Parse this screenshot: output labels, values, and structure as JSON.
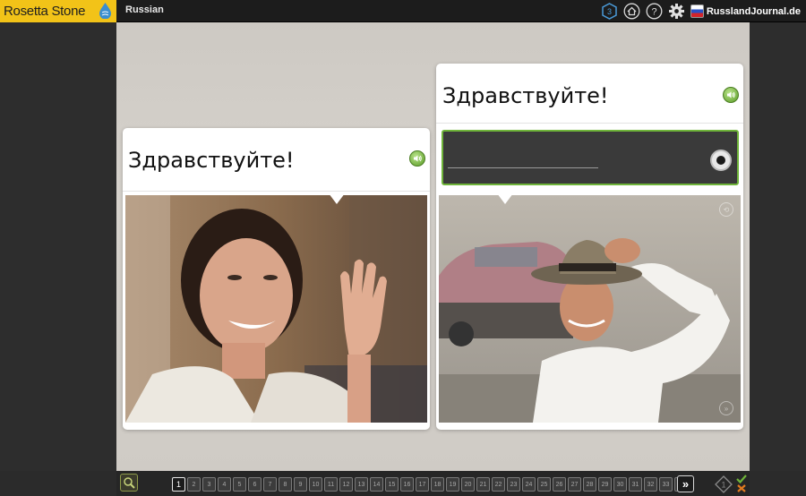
{
  "app": {
    "logo_text": "Rosetta Stone",
    "course": "Russian",
    "brand_text": "RusslandJournal.de",
    "top_icons": [
      "level-badge-icon",
      "home-icon",
      "help-icon",
      "gear-icon"
    ],
    "level_badge": "3"
  },
  "cards": [
    {
      "phrase": "Здравствуйте!",
      "speaker_icon": "speaker-icon",
      "photo": "woman waving"
    },
    {
      "phrase": "Здравствуйте!",
      "speaker_icon": "speaker-icon",
      "photo": "man with hat",
      "recorder": {
        "state": "idle",
        "record_icon": "record-button-icon"
      }
    }
  ],
  "bottom": {
    "pages": [
      "1",
      "2",
      "3",
      "4",
      "5",
      "6",
      "7",
      "8",
      "9",
      "10",
      "11",
      "12",
      "13",
      "14",
      "15",
      "16",
      "17",
      "18",
      "19",
      "20",
      "21",
      "22",
      "23",
      "24",
      "25",
      "26",
      "27",
      "28",
      "29",
      "30",
      "31",
      "32",
      "33",
      "34"
    ],
    "current_page": "1",
    "next_label": "»",
    "score_badge": "1"
  },
  "colors": {
    "accent_green": "#6fb43a",
    "logo_yellow": "#f2c318"
  }
}
